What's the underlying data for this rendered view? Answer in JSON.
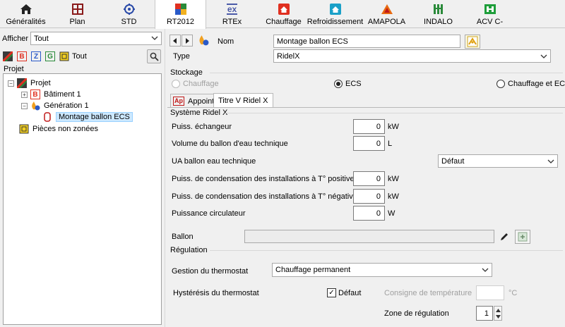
{
  "toolbar": {
    "items": [
      {
        "label": "Généralités",
        "icon": "house-icon"
      },
      {
        "label": "Plan",
        "icon": "plan-icon"
      },
      {
        "label": "STD",
        "icon": "std-icon"
      },
      {
        "label": "RT2012",
        "icon": "rt2012-icon"
      },
      {
        "label": "RTEx",
        "icon": "rtex-icon"
      },
      {
        "label": "Chauffage",
        "icon": "heating-house-icon"
      },
      {
        "label": "Refroidissement",
        "icon": "cooling-house-icon"
      },
      {
        "label": "AMAPOLA",
        "icon": "amapola-icon"
      },
      {
        "label": "INDALO",
        "icon": "indalo-icon"
      },
      {
        "label": "ACV C-",
        "icon": "acv-icon"
      }
    ],
    "active_index": 3,
    "rtex_icon_text": "ex"
  },
  "left": {
    "afficher_label": "Afficher",
    "afficher_value": "Tout",
    "filters": {
      "b": "B",
      "z": "Z",
      "g": "G",
      "tout": "Tout"
    },
    "projet_header": "Projet",
    "tree": {
      "root": "Projet",
      "batiment": "Bâtiment 1",
      "generation": "Génération 1",
      "selected": "Montage ballon ECS",
      "pieces": "Pièces non zonées"
    }
  },
  "form": {
    "nom_label": "Nom",
    "nom_value": "Montage ballon ECS",
    "type_label": "Type",
    "type_value": "RidelX",
    "stockage_label": "Stockage",
    "radio_chauffage": "Chauffage",
    "radio_ecs": "ECS",
    "radio_both": "Chauffage et ECS",
    "tab_appoint": "Appoint",
    "tab_appoint_icon_text": "Ap",
    "tab_titre": "Titre V Ridel X",
    "systeme_label": "Système Ridel X",
    "rows": [
      {
        "label": "Puiss. échangeur",
        "value": "0",
        "unit": "kW"
      },
      {
        "label": "Volume du ballon d'eau technique",
        "value": "0",
        "unit": "L"
      },
      {
        "label": "Puiss. de condensation des installations à T° positive",
        "value": "0",
        "unit": "kW"
      },
      {
        "label": "Puiss. de condensation des installations à T° négative",
        "value": "0",
        "unit": "kW"
      },
      {
        "label": "Puissance circulateur",
        "value": "0",
        "unit": "W"
      }
    ],
    "ua_label": "UA ballon eau technique",
    "ua_value": "Défaut",
    "ballon_label": "Ballon",
    "ballon_value": "",
    "regulation_label": "Régulation",
    "gestion_label": "Gestion du thermostat",
    "gestion_value": "Chauffage permanent",
    "hysteresis_label": "Hystérésis du thermostat",
    "defaut_label": "Défaut",
    "consigne_label": "Consigne de température",
    "consigne_value": "",
    "consigne_unit": "°C",
    "zone_label": "Zone de régulation",
    "zone_value": "1"
  },
  "colors": {
    "accent_red": "#e03020",
    "select_bg": "#cce8ff",
    "green": "#1e9e3a"
  }
}
